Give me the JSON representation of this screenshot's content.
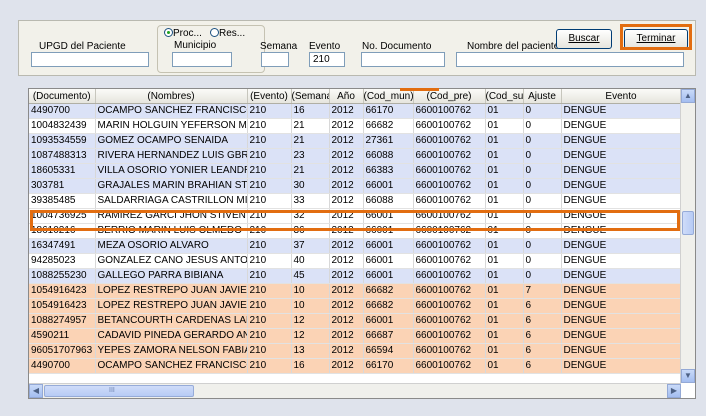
{
  "filters": {
    "upgd_label": "UPGD del Paciente",
    "upgd_value": "",
    "radio_proc": "Proc...",
    "radio_res": "Res...",
    "municipio_label": "Municipio",
    "municipio_value": "",
    "semana_label": "Semana",
    "semana_value": "",
    "evento_label": "Evento",
    "evento_value": "210",
    "documento_label": "No. Documento",
    "documento_value": "",
    "nombre_label": "Nombre del paciente",
    "nombre_value": ""
  },
  "buttons": {
    "buscar": "Buscar",
    "terminar": "Terminar"
  },
  "grid": {
    "columns": [
      "(Documento)",
      "(Nombres)",
      "(Evento)",
      "(Semana",
      "Año",
      "(Cod_mun)",
      "(Cod_pre)",
      "(Cod_sub)",
      "Ajuste",
      "Evento"
    ],
    "rows": [
      {
        "c": [
          "4490700",
          "OCAMPO SANCHEZ FRANCISCO ANTC",
          "210",
          "16",
          "2012",
          "66170",
          "6600100762",
          "01",
          "0",
          "DENGUE"
        ]
      },
      {
        "c": [
          "1004832439",
          "MARIN HOLGUIN YEFERSON MAURICIO",
          "210",
          "21",
          "2012",
          "66682",
          "6600100762",
          "01",
          "0",
          "DENGUE"
        ]
      },
      {
        "c": [
          "1093534559",
          "GOMEZ OCAMPO SENAIDA",
          "210",
          "21",
          "2012",
          "27361",
          "6600100762",
          "01",
          "0",
          "DENGUE"
        ]
      },
      {
        "c": [
          "1087488313",
          "RIVERA HERNANDEZ LUIS GBRIEL",
          "210",
          "23",
          "2012",
          "66088",
          "6600100762",
          "01",
          "0",
          "DENGUE"
        ]
      },
      {
        "c": [
          "18605331",
          "VILLA OSORIO YONIER LEANDRO",
          "210",
          "21",
          "2012",
          "66383",
          "6600100762",
          "01",
          "0",
          "DENGUE"
        ]
      },
      {
        "c": [
          "303781",
          "GRAJALES MARIN BRAHIAN STIVEN",
          "210",
          "30",
          "2012",
          "66001",
          "6600100762",
          "01",
          "0",
          "DENGUE"
        ]
      },
      {
        "c": [
          "39385485",
          "SALDARRIAGA CASTRILLON MIRIAM F",
          "210",
          "33",
          "2012",
          "66088",
          "6600100762",
          "01",
          "0",
          "DENGUE"
        ]
      },
      {
        "c": [
          "1004736925",
          "RAMIREZ GARCI JHON STIVEN",
          "210",
          "32",
          "2012",
          "66001",
          "6600100762",
          "01",
          "0",
          "DENGUE"
        ]
      },
      {
        "c": [
          "18610216",
          "BERRIO MARIN LUIS OLMEDO",
          "210",
          "36",
          "2012",
          "66001",
          "6600100762",
          "01",
          "0",
          "DENGUE"
        ]
      },
      {
        "c": [
          "16347491",
          "MEZA OSORIO ALVARO",
          "210",
          "37",
          "2012",
          "66001",
          "6600100762",
          "01",
          "0",
          "DENGUE"
        ]
      },
      {
        "c": [
          "94285023",
          "GONZALEZ CANO JESUS ANTONIO",
          "210",
          "40",
          "2012",
          "66001",
          "6600100762",
          "01",
          "0",
          "DENGUE"
        ]
      },
      {
        "c": [
          "1088255230",
          "GALLEGO PARRA BIBIANA",
          "210",
          "45",
          "2012",
          "66001",
          "6600100762",
          "01",
          "0",
          "DENGUE"
        ]
      },
      {
        "c": [
          "1054916423",
          "LOPEZ RESTREPO JUAN JAVIER",
          "210",
          "10",
          "2012",
          "66682",
          "6600100762",
          "01",
          "7",
          "DENGUE"
        ]
      },
      {
        "c": [
          "1054916423",
          "LOPEZ RESTREPO JUAN JAVIER",
          "210",
          "10",
          "2012",
          "66682",
          "6600100762",
          "01",
          "6",
          "DENGUE"
        ]
      },
      {
        "c": [
          "1088274957",
          "BETANCOURTH CARDENAS LADY JOH",
          "210",
          "12",
          "2012",
          "66001",
          "6600100762",
          "01",
          "6",
          "DENGUE"
        ]
      },
      {
        "c": [
          "4590211",
          "CADAVID PINEDA GERARDO ANTONIO",
          "210",
          "12",
          "2012",
          "66687",
          "6600100762",
          "01",
          "6",
          "DENGUE"
        ]
      },
      {
        "c": [
          "96051707963",
          "YEPES ZAMORA NELSON FABIAN",
          "210",
          "13",
          "2012",
          "66594",
          "6600100762",
          "01",
          "6",
          "DENGUE"
        ]
      },
      {
        "c": [
          "4490700",
          "OCAMPO SANCHEZ FRANCISCO ANTC",
          "210",
          "16",
          "2012",
          "66170",
          "6600100762",
          "01",
          "6",
          "DENGUE"
        ]
      }
    ],
    "row_colors": [
      "blue",
      "white",
      "blue",
      "blue",
      "blue",
      "blue",
      "white",
      "white",
      "white",
      "blue",
      "white",
      "blue",
      "orange",
      "orange",
      "orange",
      "orange",
      "orange",
      "orange"
    ],
    "scroll_up": "▲",
    "scroll_down": "▼",
    "scroll_left": "◀",
    "scroll_right": "▶",
    "hscroll_grip": "III"
  },
  "colors": {
    "highlight": "#e26d10",
    "row_blue": "#dbe2f7",
    "row_orange": "#fbd3b5"
  }
}
